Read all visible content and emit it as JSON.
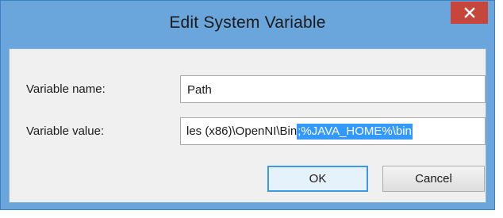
{
  "window": {
    "title": "Edit System Variable",
    "close_icon": "close-icon"
  },
  "form": {
    "name_label": "Variable name:",
    "name_value": "Path",
    "value_label": "Variable value:",
    "value_unselected": "les (x86)\\OpenNI\\Bin",
    "value_selected": ";%JAVA_HOME%\\bin"
  },
  "buttons": {
    "ok_label": "OK",
    "cancel_label": "Cancel"
  },
  "colors": {
    "title_bar": "#6aa6dc",
    "close_button": "#c7463b",
    "selection": "#3399ff"
  }
}
